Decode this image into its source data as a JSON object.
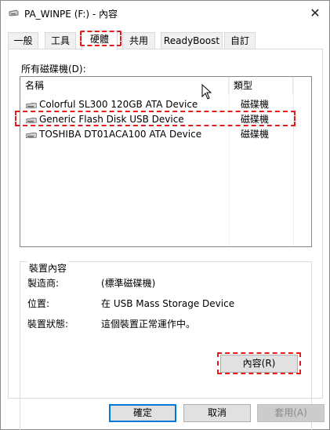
{
  "window": {
    "title": "PA_WINPE (F:) - 內容",
    "close_glyph": "✕"
  },
  "tabs": [
    {
      "label": "一般"
    },
    {
      "label": "工具"
    },
    {
      "label": "硬體"
    },
    {
      "label": "共用"
    },
    {
      "label": "ReadyBoost"
    },
    {
      "label": "自訂"
    }
  ],
  "active_tab": "硬體",
  "panel": {
    "all_disks_label": "所有磁碟機(D):",
    "columns": {
      "name": "名稱",
      "type": "類型"
    },
    "devices": [
      {
        "name": "Colorful SL300 120GB ATA Device",
        "type": "磁碟機"
      },
      {
        "name": "Generic Flash Disk USB Device",
        "type": "磁碟機"
      },
      {
        "name": "TOSHIBA DT01ACA100 ATA Device",
        "type": "磁碟機"
      }
    ],
    "properties": {
      "title": "裝置內容",
      "manufacturer_label": "製造商:",
      "manufacturer_value": "(標準磁碟機)",
      "location_label": "位置:",
      "location_value": "在 USB Mass Storage Device",
      "status_label": "裝置狀態:",
      "status_value": "這個裝置正常運作中。",
      "properties_button": "內容(R)"
    }
  },
  "footer": {
    "ok": "確定",
    "cancel": "取消",
    "apply": "套用(A)"
  },
  "colors": {
    "highlight": "#e31b1b",
    "default_button_border": "#0078d7"
  }
}
